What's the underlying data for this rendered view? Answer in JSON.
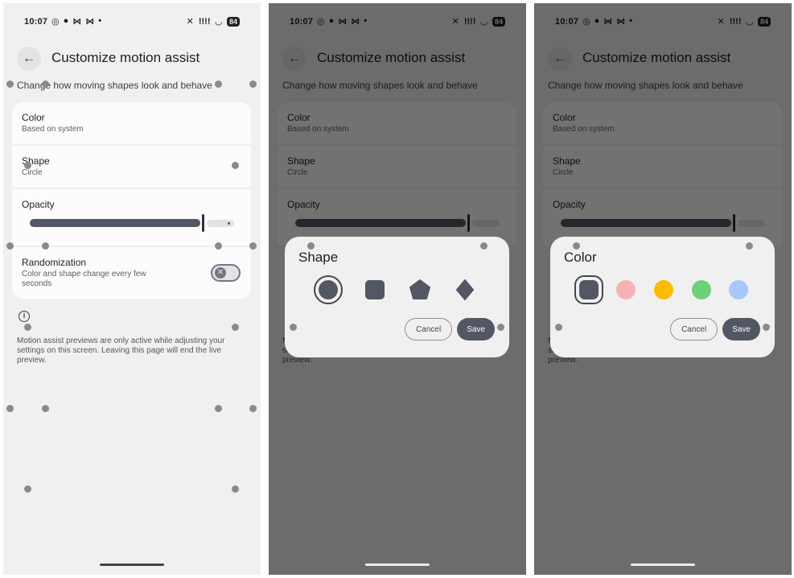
{
  "status_bar": {
    "time": "10:07",
    "battery": "84",
    "signal": "!!!!"
  },
  "page": {
    "title": "Customize motion assist",
    "subtitle": "Change how moving shapes look and behave"
  },
  "settings": {
    "color": {
      "title": "Color",
      "value": "Based on system"
    },
    "shape": {
      "title": "Shape",
      "value": "Circle"
    },
    "opacity": {
      "title": "Opacity",
      "level": 0.88
    },
    "randomization": {
      "title": "Randomization",
      "description": "Color and shape change every few seconds",
      "enabled": false
    }
  },
  "info": {
    "text": "Motion assist previews are only active while adjusting your settings on this screen. Leaving this page will end the live preview.",
    "icon": "info-icon"
  },
  "shape_dialog": {
    "title": "Shape",
    "options": [
      "circle",
      "rounded-square",
      "pentagon",
      "diamond"
    ],
    "selected": "circle",
    "cancel_label": "Cancel",
    "save_label": "Save"
  },
  "color_dialog": {
    "title": "Color",
    "options": [
      "#535763",
      "#f4b4b4",
      "#fbbc04",
      "#6fd07a",
      "#a8c7fa"
    ],
    "selected": "#535763",
    "cancel_label": "Cancel",
    "save_label": "Save"
  },
  "colors": {
    "accent": "#535763",
    "background": "#f1f0f1",
    "card": "#fcfcfc"
  }
}
